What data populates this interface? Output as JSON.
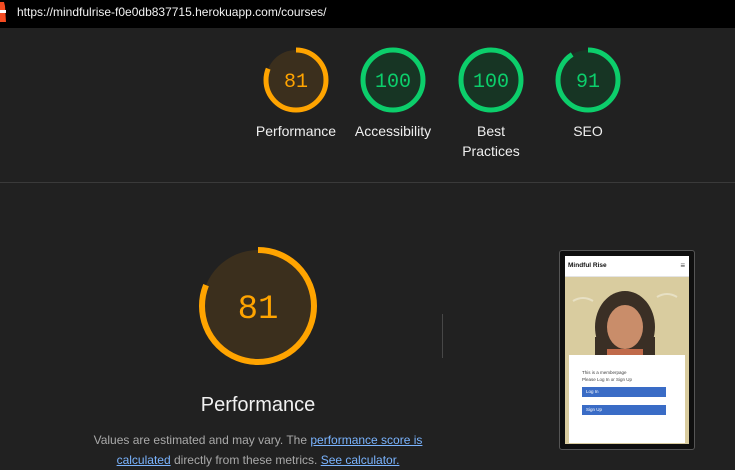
{
  "address_bar": {
    "url": "https://mindfulrise-f0e0db837715.herokuapp.com/courses/"
  },
  "colors": {
    "pass": "#0cce6b",
    "average": "#ffa400",
    "background": "#212121"
  },
  "gauges": [
    {
      "label": "Performance",
      "score": 81,
      "status": "average"
    },
    {
      "label": "Accessibility",
      "score": 100,
      "status": "pass"
    },
    {
      "label": "Best Practices",
      "score": 100,
      "status": "pass"
    },
    {
      "label": "SEO",
      "score": 91,
      "status": "pass"
    }
  ],
  "performance": {
    "score": 81,
    "label": "Performance",
    "note_prefix": "Values are estimated and may vary. The ",
    "score_link": "performance score is calculated",
    "note_middle": " directly from these metrics. ",
    "calc_link": "See calculator."
  },
  "screenshot": {
    "brand": "Mindful Rise",
    "menu_icon": "hamburger-icon",
    "line1": "This is a memberpage",
    "line2": "Please Log In or Sign Up",
    "login": "Log In",
    "signup": "Sign Up"
  }
}
